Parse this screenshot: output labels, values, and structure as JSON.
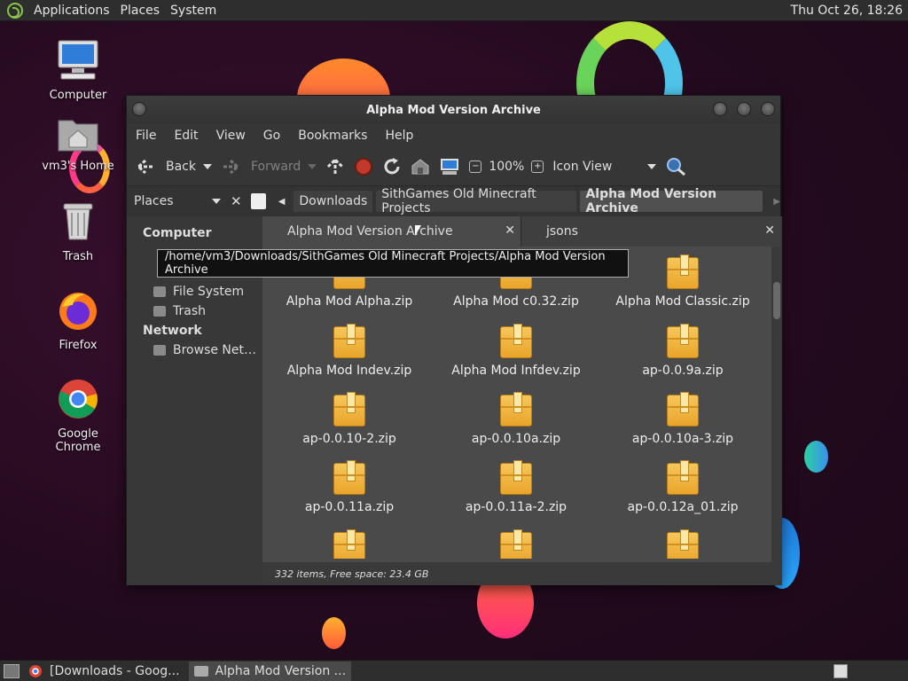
{
  "top_panel": {
    "menus": [
      "Applications",
      "Places",
      "System"
    ],
    "clock": "Thu Oct 26, 18:26"
  },
  "desktop": {
    "icons": [
      "Computer",
      "vm3's Home",
      "Trash",
      "Firefox",
      "Google Chrome"
    ]
  },
  "window": {
    "title": "Alpha Mod Version Archive",
    "menus": [
      "File",
      "Edit",
      "View",
      "Go",
      "Bookmarks",
      "Help"
    ],
    "toolbar": {
      "back": "Back",
      "forward": "Forward",
      "zoom": "100%",
      "view": "Icon View"
    },
    "places_label": "Places",
    "breadcrumbs": [
      "Downloads",
      "SithGames Old Minecraft Projects",
      "Alpha Mod Version Archive"
    ],
    "sidebar": {
      "computer_header": "Computer",
      "computer_items": [
        "File System",
        "Trash"
      ],
      "network_header": "Network",
      "network_items": [
        "Browse Net…"
      ]
    },
    "tabs": [
      "Alpha Mod Version Archive",
      "jsons"
    ],
    "tooltip": "/home/vm3/Downloads/SithGames Old Minecraft Projects/Alpha Mod Version Archive",
    "files": [
      "Alpha Mod Alpha.zip",
      "Alpha Mod c0.32.zip",
      "Alpha Mod Classic.zip",
      "Alpha Mod Indev.zip",
      "Alpha Mod Infdev.zip",
      "ap-0.0.9a.zip",
      "ap-0.0.10-2.zip",
      "ap-0.0.10a.zip",
      "ap-0.0.10a-3.zip",
      "ap-0.0.11a.zip",
      "ap-0.0.11a-2.zip",
      "ap-0.0.12a_01.zip"
    ],
    "status": "332 items, Free space: 23.4 GB"
  },
  "taskbar": {
    "tasks": [
      "[Downloads - Goog...",
      "Alpha Mod Version ..."
    ]
  }
}
